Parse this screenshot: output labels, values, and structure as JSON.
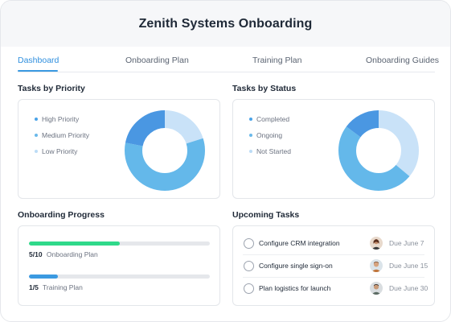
{
  "app": {
    "title": "Zenith Systems Onboarding"
  },
  "tabs": [
    {
      "label": "Dashboard",
      "active": true
    },
    {
      "label": "Onboarding Plan",
      "active": false
    },
    {
      "label": "Training Plan",
      "active": false
    },
    {
      "label": "Onboarding Guides",
      "active": false
    }
  ],
  "priority": {
    "title": "Tasks by Priority",
    "legend": [
      {
        "label": "High Priority",
        "color": "#4aa3e8"
      },
      {
        "label": "Medium Priority",
        "color": "#6ab9ea"
      },
      {
        "label": "Low Priority",
        "color": "#bcdcf6"
      }
    ],
    "slices": [
      {
        "label": "Low Priority",
        "value": 0.2,
        "color": "#c9e2f8"
      },
      {
        "label": "High Priority",
        "value": 0.58,
        "color": "#64b8ea"
      },
      {
        "label": "Medium Priority",
        "value": 0.22,
        "color": "#4a97e2"
      }
    ]
  },
  "status": {
    "title": "Tasks by Status",
    "legend": [
      {
        "label": "Completed",
        "color": "#4aa3e8"
      },
      {
        "label": "Ongoing",
        "color": "#6ab9ea"
      },
      {
        "label": "Not Started",
        "color": "#bcdcf6"
      }
    ],
    "slices": [
      {
        "label": "Not Started",
        "value": 0.36,
        "color": "#c9e2f8"
      },
      {
        "label": "Ongoing",
        "value": 0.49,
        "color": "#64b8ea"
      },
      {
        "label": "Completed",
        "value": 0.15,
        "color": "#4a97e2"
      }
    ]
  },
  "progress": {
    "title": "Onboarding Progress",
    "items": [
      {
        "count": "5/10",
        "label": "Onboarding Plan",
        "fraction": 0.5,
        "color": "#2fd98a"
      },
      {
        "count": "1/5",
        "label": "Training Plan",
        "fraction": 0.16,
        "color": "#3b9ae1"
      }
    ]
  },
  "upcoming": {
    "title": "Upcoming Tasks",
    "tasks": [
      {
        "name": "Configure CRM integration",
        "due": "Due June 7",
        "avatar_color": "#a0522d"
      },
      {
        "name": "Configure single sign-on",
        "due": "Due June 15",
        "avatar_color": "#8b5a3c"
      },
      {
        "name": "Plan logistics for launch",
        "due": "Due June 30",
        "avatar_color": "#6b5a4e"
      }
    ]
  }
}
